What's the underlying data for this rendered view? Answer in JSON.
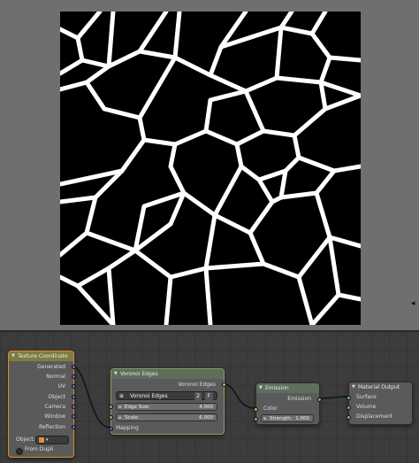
{
  "texture_coordinate": {
    "title": "Texture Coordinate",
    "outputs": [
      "Generated",
      "Normal",
      "UV",
      "Object",
      "Camera",
      "Window",
      "Reflection"
    ],
    "object_label": "Object:",
    "from_dupli_label": "From Dupli",
    "from_dupli_checked": false
  },
  "voronoi_edges": {
    "title": "Voronoi Edges",
    "output_label": "Voronoi Edges",
    "datablock_name": "Voronoi Edges",
    "user_count": "2",
    "fake_user": "F",
    "edge_size_label": "Edge Size:",
    "edge_size_value": "4.000",
    "scale_label": "Scale:",
    "scale_value": "6.000",
    "mapping_label": "Mapping"
  },
  "emission": {
    "title": "Emission",
    "output_label": "Emission",
    "color_label": "Color",
    "strength_label": "Strength:",
    "strength_value": "1.000"
  },
  "material_output": {
    "title": "Material Output",
    "inputs": [
      "Surface",
      "Volume",
      "Displacement"
    ]
  },
  "colors": {
    "vector_socket": "#6464c8",
    "color_socket": "#c7c729",
    "value_socket": "#a1a1a1",
    "shader_socket": "#63c763",
    "selected_node_outline": "#e08a2a"
  }
}
